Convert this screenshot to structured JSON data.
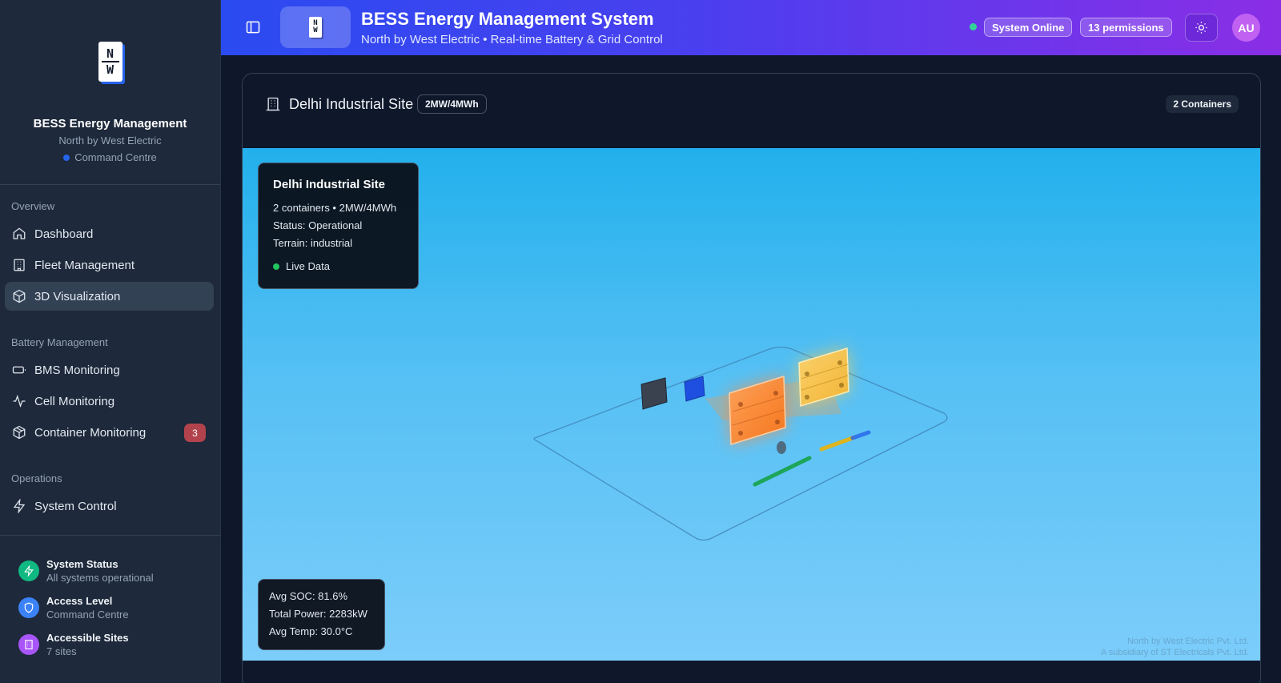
{
  "sidebar": {
    "logo_text": [
      "N",
      "W"
    ],
    "brand_title": "BESS Energy Management",
    "brand_subtitle": "North by West Electric",
    "brand_tag": "Command Centre",
    "sections": [
      {
        "title": "Overview",
        "items": [
          {
            "label": "Dashboard",
            "icon": "home-icon"
          },
          {
            "label": "Fleet Management",
            "icon": "building-icon"
          },
          {
            "label": "3D Visualization",
            "icon": "cube-icon",
            "active": true
          }
        ]
      },
      {
        "title": "Battery Management",
        "items": [
          {
            "label": "BMS Monitoring",
            "icon": "battery-icon"
          },
          {
            "label": "Cell Monitoring",
            "icon": "activity-icon"
          },
          {
            "label": "Container Monitoring",
            "icon": "package-icon",
            "badge": "3"
          }
        ]
      },
      {
        "title": "Operations",
        "items": [
          {
            "label": "System Control",
            "icon": "zap-icon"
          }
        ]
      }
    ],
    "footer": [
      {
        "title": "System Status",
        "subtitle": "All systems operational",
        "color": "#10b981",
        "icon": "zap-icon"
      },
      {
        "title": "Access Level",
        "subtitle": "Command Centre",
        "color": "#3b82f6",
        "icon": "shield-icon"
      },
      {
        "title": "Accessible Sites",
        "subtitle": "7 sites",
        "color": "#a855f7",
        "icon": "building-icon"
      }
    ]
  },
  "header": {
    "title": "BESS Energy Management System",
    "subtitle": "North by West Electric • Real-time Battery & Grid Control",
    "status": "System Online",
    "permissions": "13 permissions",
    "avatar": "AU",
    "gradient": [
      "#2a4bf0",
      "#8a2ee6"
    ]
  },
  "main": {
    "site_name": "Delhi Industrial Site",
    "capacity": "2MW/4MWh",
    "containers": "2 Containers",
    "info": {
      "title": "Delhi Industrial Site",
      "lines": [
        "2 containers • 2MW/4MWh",
        "Status: Operational",
        "Terrain: industrial"
      ],
      "live": "Live Data"
    },
    "stats": [
      "Avg SOC: 81.6%",
      "Total Power: 2283kW",
      "Avg Temp: 30.0°C"
    ],
    "watermark": [
      "North by West Electric Pvt. Ltd.",
      "A subsidiary of ST Electricals Pvt. Ltd."
    ]
  }
}
